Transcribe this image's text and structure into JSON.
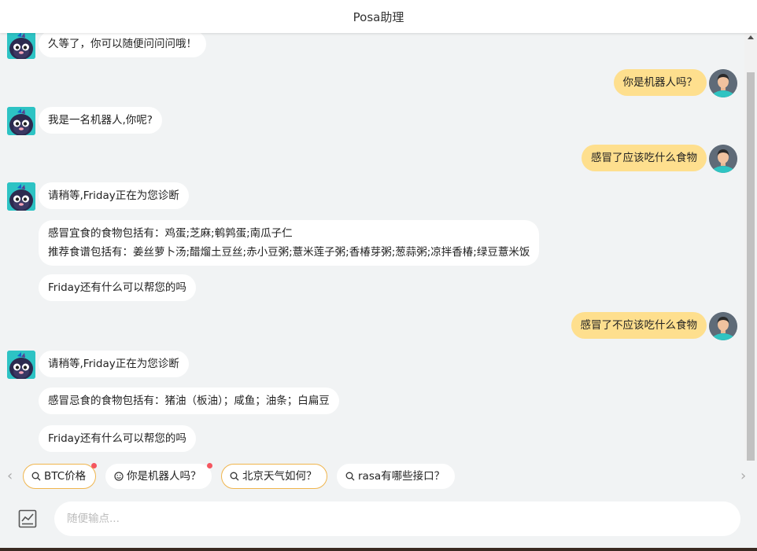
{
  "header": {
    "title": "Posa助理"
  },
  "messages": [
    {
      "from": "bot",
      "text": "久等了，你可以随便问问问哦！"
    },
    {
      "from": "user",
      "text": "你是机器人吗？"
    },
    {
      "from": "bot",
      "text": "我是一名机器人,你呢?"
    },
    {
      "from": "user",
      "text": "感冒了应该吃什么食物"
    },
    {
      "from": "bot",
      "text": "请稍等,Friday正在为您诊断"
    },
    {
      "from": "bot",
      "lines": [
        "感冒宜食的食物包括有：鸡蛋;芝麻;鹌鹑蛋;南瓜子仁",
        "推荐食谱包括有：姜丝萝卜汤;醋熘土豆丝;赤小豆粥;薏米莲子粥;香椿芽粥;葱蒜粥;凉拌香椿;绿豆薏米饭"
      ]
    },
    {
      "from": "bot",
      "text": "Friday还有什么可以帮您的吗"
    },
    {
      "from": "user",
      "text": "感冒了不应该吃什么食物"
    },
    {
      "from": "bot",
      "text": "请稍等,Friday正在为您诊断"
    },
    {
      "from": "bot",
      "text": "感冒忌食的食物包括有：猪油（板油）；咸鱼；油条；白扁豆"
    },
    {
      "from": "bot",
      "text": "Friday还有什么可以帮您的吗"
    }
  ],
  "suggestions": [
    {
      "label": "BTC价格",
      "icon": "search-icon",
      "hot": true,
      "badge": true
    },
    {
      "label": "你是机器人吗？",
      "icon": "smile-icon",
      "hot": false,
      "badge": true
    },
    {
      "label": "北京天气如何？",
      "icon": "search-icon",
      "hot": true,
      "badge": false
    },
    {
      "label": "rasa有哪些接口？",
      "icon": "search-icon",
      "hot": false,
      "badge": false
    }
  ],
  "input": {
    "placeholder": "随便输点...",
    "value": ""
  },
  "colors": {
    "user_bubble": "#fedf8e",
    "bot_bubble": "#ffffff",
    "chip_border": "#f0b54d",
    "badge": "#f5565f",
    "background": "#f1f3f4"
  }
}
